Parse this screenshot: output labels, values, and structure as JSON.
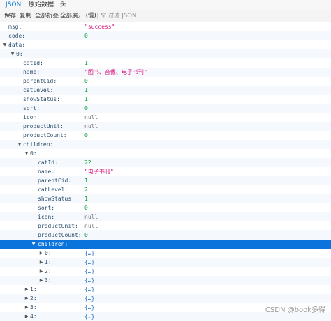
{
  "tabs": [
    "JSON",
    "原始数据",
    "头"
  ],
  "toolbar": {
    "save": "保存",
    "copy": "复制",
    "collapse_all": "全部折叠",
    "expand_all": "全部展开 (慢)",
    "filter_placeholder": "过滤 JSON"
  },
  "tree": {
    "msg": {
      "key": "msg:",
      "value": "\"success\""
    },
    "code": {
      "key": "code:",
      "value": "0"
    },
    "data": {
      "key": "data:"
    },
    "item0": {
      "key": "0:",
      "catId": {
        "key": "catId:",
        "value": "1"
      },
      "name": {
        "key": "name:",
        "value": "\"图书、音像、电子书刊\""
      },
      "parentCid": {
        "key": "parentCid:",
        "value": "0"
      },
      "catLevel": {
        "key": "catLevel:",
        "value": "1"
      },
      "showStatus": {
        "key": "showStatus:",
        "value": "1"
      },
      "sort": {
        "key": "sort:",
        "value": "0"
      },
      "icon": {
        "key": "icon:",
        "value": "null"
      },
      "productUnit": {
        "key": "productUnit:",
        "value": "null"
      },
      "productCount": {
        "key": "productCount:",
        "value": "0"
      },
      "children": {
        "key": "children:"
      }
    },
    "child0": {
      "key": "0:",
      "catId": {
        "key": "catId:",
        "value": "22"
      },
      "name": {
        "key": "name:",
        "value": "\"电子书刊\""
      },
      "parentCid": {
        "key": "parentCid:",
        "value": "1"
      },
      "catLevel": {
        "key": "catLevel:",
        "value": "2"
      },
      "showStatus": {
        "key": "showStatus:",
        "value": "1"
      },
      "sort": {
        "key": "sort:",
        "value": "0"
      },
      "icon": {
        "key": "icon:",
        "value": "null"
      },
      "productUnit": {
        "key": "productUnit:",
        "value": "null"
      },
      "productCount": {
        "key": "productCount:",
        "value": "0"
      },
      "children": {
        "key": "children:"
      }
    },
    "grand": [
      {
        "key": "0:",
        "value": "{…}"
      },
      {
        "key": "1:",
        "value": "{…}"
      },
      {
        "key": "2:",
        "value": "{…}"
      },
      {
        "key": "3:",
        "value": "{…}"
      }
    ],
    "siblings": [
      {
        "key": "1:",
        "value": "{…}"
      },
      {
        "key": "2:",
        "value": "{…}"
      },
      {
        "key": "3:",
        "value": "{…}"
      },
      {
        "key": "4:",
        "value": "{…}"
      }
    ]
  },
  "watermark": "CSDN @book多得",
  "icons": {
    "expanded": "triangle-down-icon",
    "collapsed": "triangle-right-icon",
    "filter": "funnel-icon"
  }
}
